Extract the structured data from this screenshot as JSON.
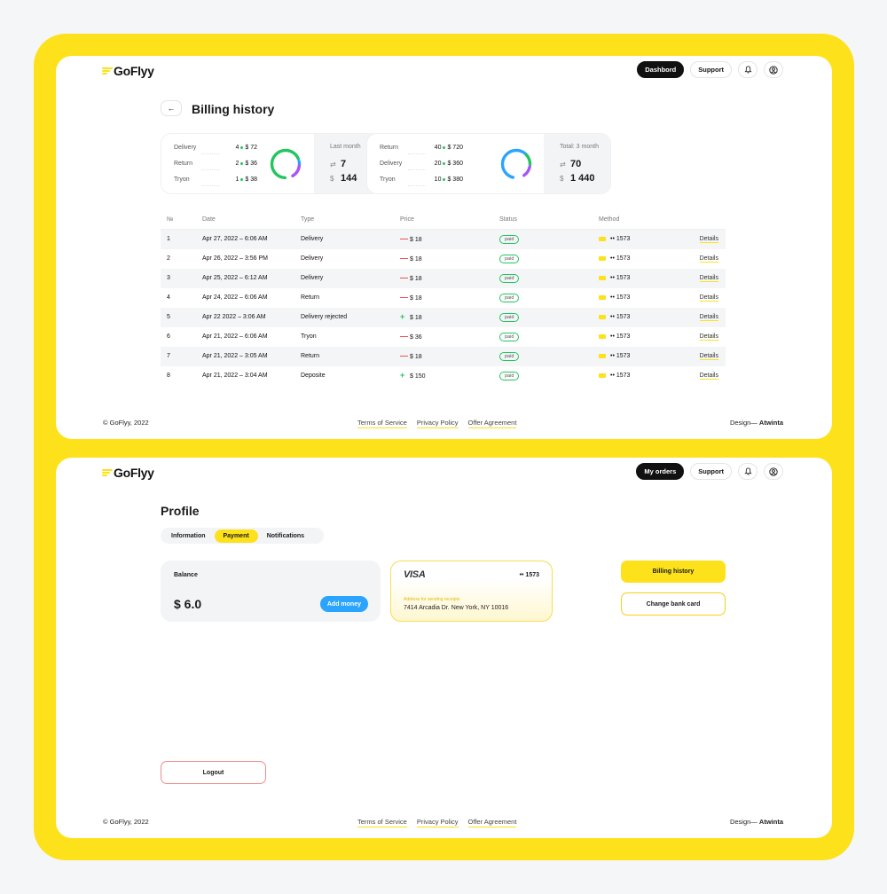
{
  "brand": {
    "name": "GoFlyy",
    "accent": "#fde11a"
  },
  "billing": {
    "nav": {
      "primary": "Dashbord",
      "support": "Support"
    },
    "back_symbol": "←",
    "title": "Billing history",
    "card1": {
      "rows": [
        {
          "label": "Delivery",
          "count": "4",
          "amount": "$ 72"
        },
        {
          "label": "Return",
          "count": "2",
          "amount": "$ 36"
        },
        {
          "label": "Tryon",
          "count": "1",
          "amount": "$ 38"
        }
      ],
      "summary_title": "Last month",
      "count": "7",
      "total": "144",
      "currency": "$"
    },
    "card2": {
      "rows": [
        {
          "label": "Return",
          "count": "40",
          "amount": "$ 720"
        },
        {
          "label": "Delivery",
          "count": "20",
          "amount": "$ 360"
        },
        {
          "label": "Tryon",
          "count": "10",
          "amount": "$ 380"
        }
      ],
      "summary_title": "Total: 3 month",
      "count": "70",
      "total": "1 440",
      "currency": "$"
    },
    "table": {
      "headers": {
        "no": "№",
        "date": "Date",
        "type": "Type",
        "price": "Price",
        "status": "Status",
        "method": "Method"
      },
      "rows": [
        {
          "no": "1",
          "date": "Apr 27, 2022 – 6:06 AM",
          "type": "Delivery",
          "sign": "—",
          "price": "$ 18",
          "status": "paid",
          "method": "•• 1573",
          "details": "Details"
        },
        {
          "no": "2",
          "date": "Apr 26, 2022 – 3:56 PM",
          "type": "Delivery",
          "sign": "—",
          "price": "$ 18",
          "status": "paid",
          "method": "•• 1573",
          "details": "Details"
        },
        {
          "no": "3",
          "date": "Apr 25, 2022 – 6:12 AM",
          "type": "Delivery",
          "sign": "—",
          "price": "$ 18",
          "status": "paid",
          "method": "•• 1573",
          "details": "Details"
        },
        {
          "no": "4",
          "date": "Apr 24, 2022 – 6:06 AM",
          "type": "Return",
          "sign": "—",
          "price": "$ 18",
          "status": "paid",
          "method": "•• 1573",
          "details": "Details"
        },
        {
          "no": "5",
          "date": "Apr 22 2022 – 3:06 AM",
          "type": "Delivery rejected",
          "sign": "+",
          "price": "$ 18",
          "status": "paid",
          "method": "•• 1573",
          "details": "Details"
        },
        {
          "no": "6",
          "date": "Apr 21, 2022 – 6:06 AM",
          "type": "Tryon",
          "sign": "—",
          "price": "$ 36",
          "status": "paid",
          "method": "•• 1573",
          "details": "Details"
        },
        {
          "no": "7",
          "date": "Apr 21, 2022 – 3:05 AM",
          "type": "Return",
          "sign": "—",
          "price": "$ 18",
          "status": "paid",
          "method": "•• 1573",
          "details": "Details"
        },
        {
          "no": "8",
          "date": "Apr 21, 2022 – 3:04 AM",
          "type": "Deposite",
          "sign": "+",
          "price": "$ 150",
          "status": "paid",
          "method": "•• 1573",
          "details": "Details"
        }
      ]
    }
  },
  "profile": {
    "nav": {
      "primary": "My orders",
      "support": "Support"
    },
    "title": "Profile",
    "tabs": [
      "Information",
      "Payment",
      "Notifications"
    ],
    "balance": {
      "label": "Balance",
      "value": "$ 6.0",
      "button": "Add money"
    },
    "card": {
      "brand": "VISA",
      "number": "•• 1573",
      "address_label": "Address for sending receipts",
      "address": "7414 Arcadia Dr. New York, NY 10016"
    },
    "billing_button": "Billing history",
    "change_button": "Change bank card",
    "logout_button": "Logout"
  },
  "footer": {
    "copyright": "© GoFlyy, 2022",
    "links": [
      "Terms of Service",
      "Privacy Policy",
      "Offer Agreement"
    ],
    "design_prefix": "Design—",
    "design_name": "Atwinta"
  }
}
